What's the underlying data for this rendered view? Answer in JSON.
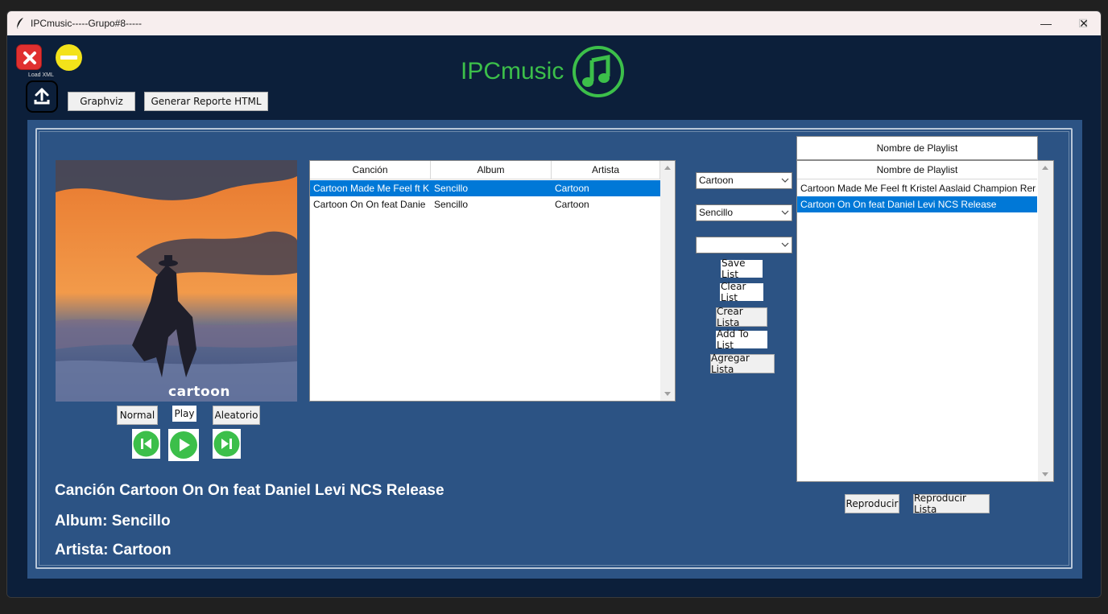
{
  "window": {
    "title": "IPCmusic-----Grupo#8-----",
    "controls": {
      "minimize": "—",
      "maximize": "☐",
      "close": "✕"
    }
  },
  "toolbar": {
    "load_xml_label": "Load XML",
    "graphviz_label": "Graphviz",
    "report_label": "Generar Reporte HTML"
  },
  "logo": {
    "text": "IPCmusic",
    "icon": "music-note-icon",
    "color": "#3cbf4a"
  },
  "cover": {
    "text": "cartoon"
  },
  "songs_table": {
    "columns": [
      "Canción",
      "Album",
      "Artista"
    ],
    "rows": [
      {
        "song": "Cartoon  Made Me Feel ft K",
        "album": "Sencillo",
        "artist": "Cartoon",
        "selected": true
      },
      {
        "song": "Cartoon  On  On feat Danie",
        "album": "Sencillo",
        "artist": "Cartoon",
        "selected": false
      }
    ]
  },
  "filters": {
    "artist_value": "Cartoon",
    "album_value": "Sencillo",
    "playlist_value": ""
  },
  "actions": {
    "save_list": "Save List",
    "clear_list": "Clear List",
    "crear_lista": "Crear Lista",
    "add_to_list": "Add To List",
    "agregar_lista": "Agregar Lista"
  },
  "playlist": {
    "name_field": "Nombre de Playlist",
    "column": "Nombre de Playlist",
    "items": [
      {
        "label": "Cartoon  Made Me Feel ft Kristel Aaslaid Champion Rer",
        "selected": false
      },
      {
        "label": "Cartoon  On  On feat Daniel Levi NCS Release",
        "selected": true
      }
    ],
    "play_label": "Reproducir",
    "play_list_label": "Reproducir Lista"
  },
  "player": {
    "normal_label": "Normal",
    "play_label": "Play",
    "random_label": "Aleatorio"
  },
  "now_playing": {
    "song": "Canción Cartoon  On  On feat Daniel Levi NCS Release",
    "album": "Album: Sencillo",
    "artist": "Artista: Cartoon"
  },
  "colors": {
    "selection": "#0078d7",
    "panel": "#2c5384",
    "background": "#0c1f3a",
    "play_green": "#3cbf4a"
  }
}
